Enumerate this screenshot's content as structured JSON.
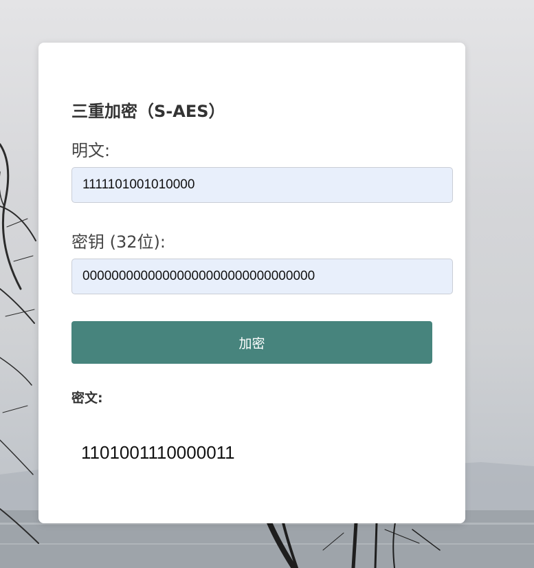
{
  "form": {
    "title": "三重加密（S-AES）",
    "plaintext_label": "明文:",
    "plaintext_value": "1111101001010000",
    "key_label": "密钥 (32位):",
    "key_value": "00000000000000000000000000000000",
    "encrypt_button": "加密",
    "ciphertext_label": "密文:",
    "ciphertext_value": "1101001110000011"
  },
  "colors": {
    "button": "#47847d",
    "input_bg": "#e8effb",
    "card_bg": "#ffffff"
  }
}
